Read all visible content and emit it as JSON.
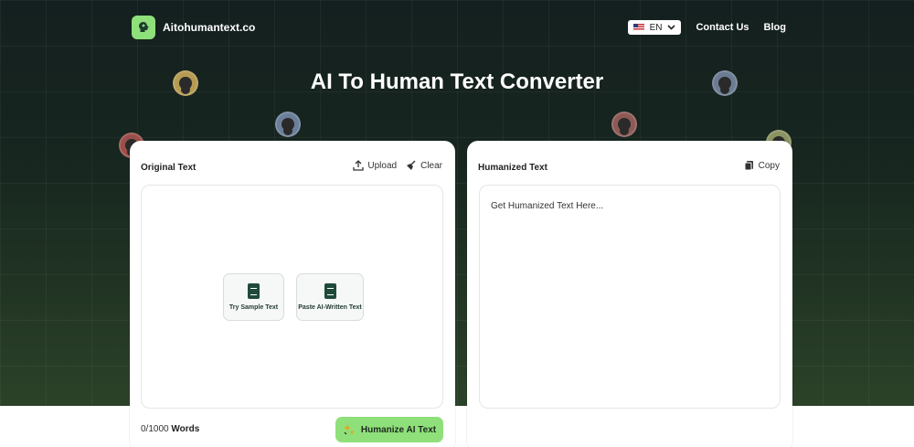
{
  "header": {
    "brand": "Aitohumantext.co",
    "lang": "EN",
    "nav": {
      "contact": "Contact Us",
      "blog": "Blog"
    }
  },
  "hero": {
    "title": "AI To Human Text Converter"
  },
  "left_card": {
    "title": "Original Text",
    "upload_label": "Upload",
    "clear_label": "Clear",
    "try_sample_label": "Try Sample Text",
    "paste_label": "Paste AI-Written Text",
    "word_count": "0/1000",
    "word_suffix": "Words",
    "humanize_label": "Humanize AI Text"
  },
  "right_card": {
    "title": "Humanized Text",
    "copy_label": "Copy",
    "output_placeholder": "Get Humanized Text Here..."
  },
  "colors": {
    "accent": "#8fe07a",
    "hero_top": "#14201f",
    "hero_bottom": "#2b4228",
    "icon_dark": "#1f4a3a"
  },
  "icons": [
    "brain-logo-icon",
    "us-flag-icon",
    "chevron-down-icon",
    "upload-icon",
    "broom-icon",
    "document-icon",
    "documents-icon",
    "sparkle-icon",
    "copy-icon"
  ]
}
